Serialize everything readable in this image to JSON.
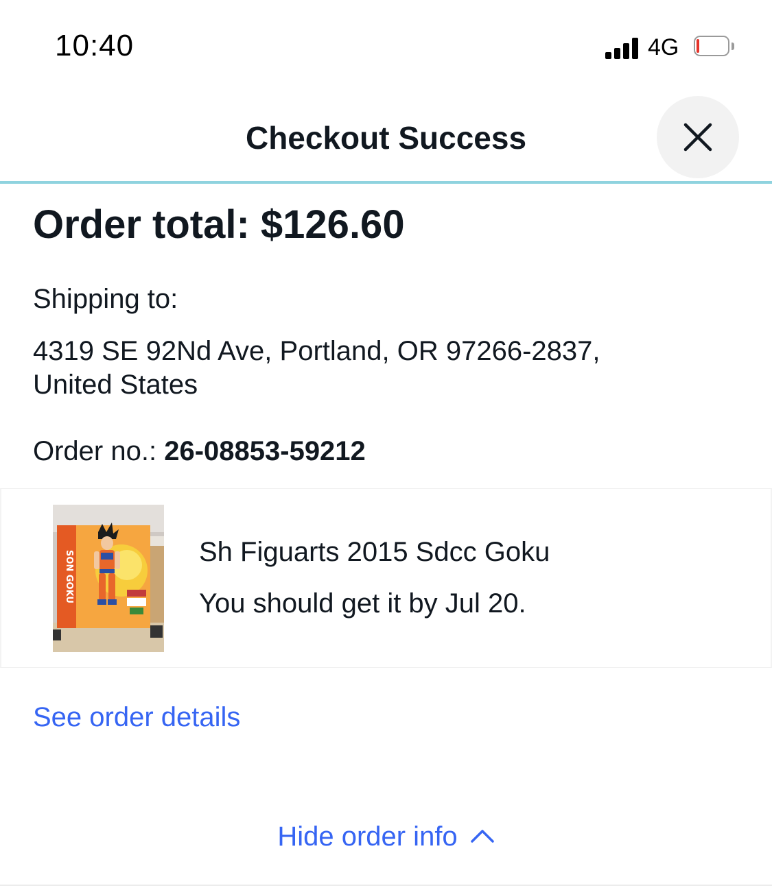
{
  "status_bar": {
    "time": "10:40",
    "network": "4G",
    "battery_level": 0.1,
    "battery_color": "#e5332a"
  },
  "header": {
    "title": "Checkout Success",
    "close_icon": "close-icon"
  },
  "order": {
    "total_text": "Order total: $126.60",
    "shipping_label": "Shipping to:",
    "address_line1": "4319 SE 92Nd Ave, Portland, OR 97266-2837,",
    "address_line2": "United States",
    "order_no_label": "Order no.: ",
    "order_no_value": "26-08853-59212"
  },
  "item": {
    "image_icon": "product-photo",
    "box_text": "SON GOKU",
    "title": "Sh Figuarts 2015 Sdcc Goku",
    "delivery": "You should get it by Jul 20."
  },
  "links": {
    "see_details": "See order details",
    "hide_info": "Hide order info",
    "hide_icon": "chevron-up-icon"
  },
  "colors": {
    "link": "#3665f3",
    "divider": "#8fd3df",
    "text": "#111820"
  }
}
